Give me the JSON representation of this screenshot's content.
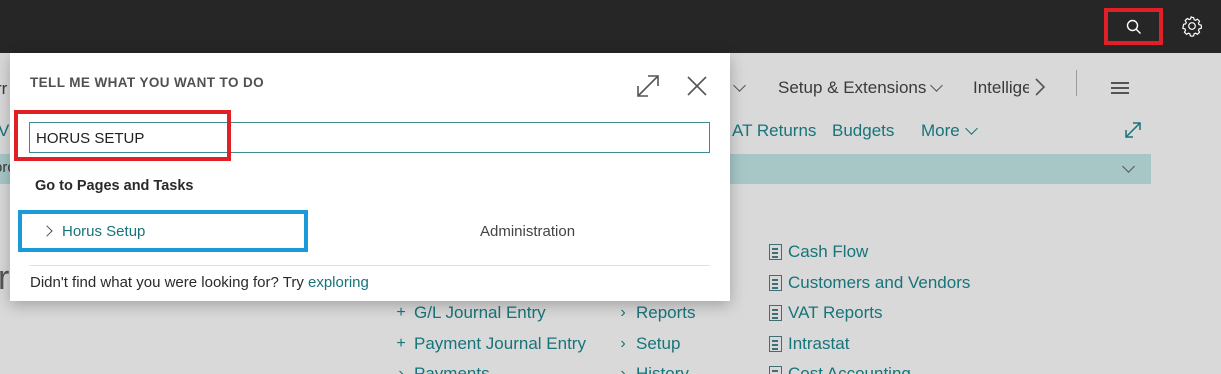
{
  "topbar": {
    "search_icon": "search-icon",
    "settings_icon": "gear-icon"
  },
  "background": {
    "nav_left_fragment": "rr",
    "nav_setup_extensions": "Setup & Extensions",
    "nav_intelligence": "Intellige",
    "nav_row2_left": "V",
    "nav_vat_returns": "AT Returns",
    "nav_budgets": "Budgets",
    "nav_more": "More",
    "band_left": "orc",
    "big_letter": "r(",
    "actions": [
      "G/L Journal Entry",
      "Payment Journal Entry",
      "Payments"
    ],
    "links": [
      "Reports",
      "Setup",
      "History"
    ],
    "reports": [
      "Cash Flow",
      "Customers and Vendors",
      "VAT Reports",
      "Intrastat",
      "Cost Accounting"
    ]
  },
  "dialog": {
    "title": "TELL ME WHAT YOU WANT TO DO",
    "search_value": "HORUS SETUP",
    "section_heading": "Go to Pages and Tasks",
    "result": {
      "name": "Horus Setup",
      "category": "Administration"
    },
    "footer_text": "Didn't find what you were looking for? Try ",
    "footer_link": "exploring"
  }
}
